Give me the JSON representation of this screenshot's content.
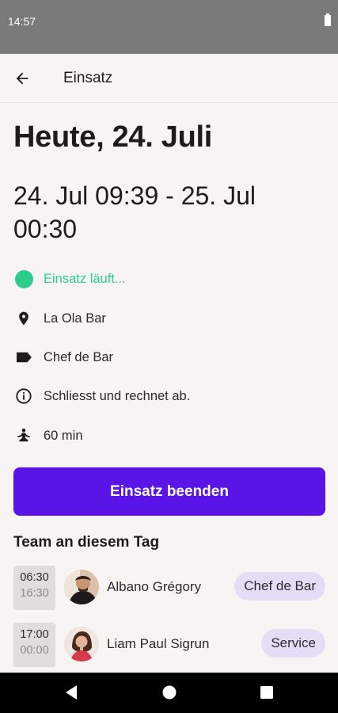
{
  "status_bar": {
    "time": "14:57"
  },
  "app_bar": {
    "title": "Einsatz"
  },
  "heading": "Heute, 24. Juli",
  "time_range": "24. Jul 09:39 - 25. Jul 00:30",
  "info": {
    "status": "Einsatz läuft...",
    "location": "La Ola Bar",
    "role": "Chef de Bar",
    "note": "Schliesst und rechnet ab.",
    "break": "60 min"
  },
  "end_button": "Einsatz beenden",
  "team": {
    "title": "Team an diesem Tag",
    "members": [
      {
        "start": "06:30",
        "end": "16:30",
        "name": "Albano Grégory",
        "role": "Chef de Bar"
      },
      {
        "start": "17:00",
        "end": "00:00",
        "name": "Liam Paul Sigrun",
        "role": "Service"
      }
    ]
  },
  "colors": {
    "accent": "#5a15e6",
    "status_running": "#2ecc8a",
    "chip": "#e5dcf5"
  }
}
